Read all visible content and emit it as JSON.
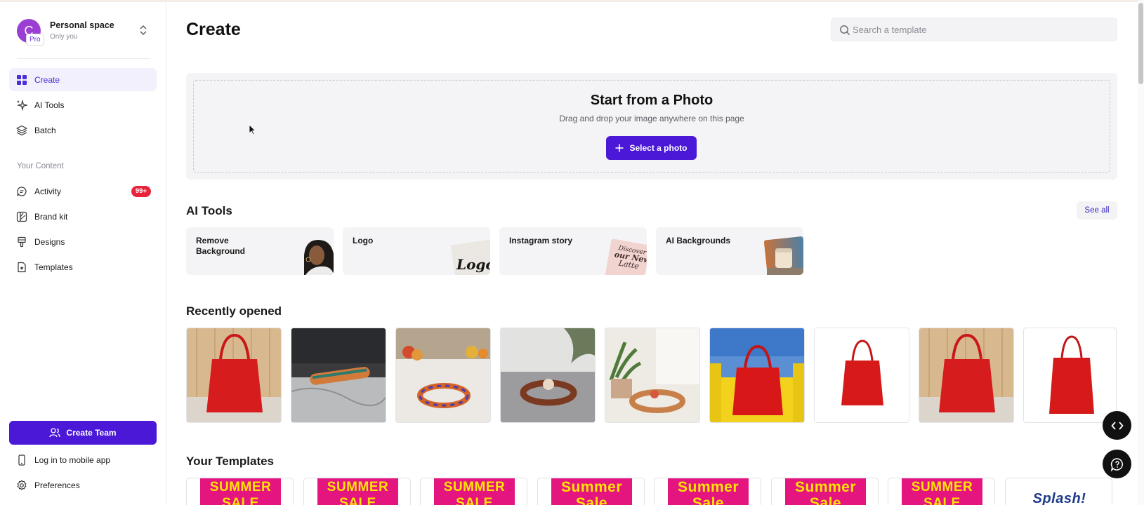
{
  "workspace": {
    "avatar_letter": "C",
    "badge": "Pro",
    "name": "Personal space",
    "subtitle": "Only you"
  },
  "sidebar": {
    "nav": [
      {
        "label": "Create",
        "icon": "grid-icon",
        "active": true
      },
      {
        "label": "AI Tools",
        "icon": "sparkles-icon",
        "active": false
      },
      {
        "label": "Batch",
        "icon": "layers-icon",
        "active": false
      }
    ],
    "content_section": "Your Content",
    "content_items": [
      {
        "label": "Activity",
        "icon": "chat-bubble-icon",
        "badge": "99+"
      },
      {
        "label": "Brand kit",
        "icon": "brand-kit-icon"
      },
      {
        "label": "Designs",
        "icon": "brush-icon"
      },
      {
        "label": "Templates",
        "icon": "template-file-icon"
      }
    ],
    "create_team": "Create Team",
    "mobile_app": "Log in to mobile app",
    "preferences": "Preferences"
  },
  "header": {
    "title": "Create",
    "search_placeholder": "Search a template"
  },
  "photo_upload": {
    "title": "Start from a Photo",
    "subtitle": "Drag and drop your image anywhere on this page",
    "button": "Select a photo"
  },
  "ai_tools": {
    "heading": "AI Tools",
    "see_all": "See all",
    "cards": [
      {
        "label": "Remove Background",
        "thumb": "portrait-woman"
      },
      {
        "label": "Logo",
        "thumb": "logos-sign",
        "thumb_text": "Logos"
      },
      {
        "label": "Instagram story",
        "thumb": "discover-latte-card",
        "thumb_text": "Discover our New Latte"
      },
      {
        "label": "AI Backgrounds",
        "thumb": "candle-jar"
      }
    ]
  },
  "recently_opened": {
    "heading": "Recently opened",
    "items": [
      {
        "name": "red-tote-wood-wall"
      },
      {
        "name": "bracelet-marble-dark"
      },
      {
        "name": "bracelet-kitchen-fruit"
      },
      {
        "name": "bracelet-shadow-plants"
      },
      {
        "name": "bracelet-window-plants"
      },
      {
        "name": "red-tote-yellow-chair"
      },
      {
        "name": "red-tote-white"
      },
      {
        "name": "red-tote-wood-wall-2"
      },
      {
        "name": "red-tote-white-2"
      }
    ]
  },
  "your_templates": {
    "heading": "Your Templates",
    "items": [
      {
        "line1": "SUMMER",
        "line2": "SALE"
      },
      {
        "line1": "SUMMER",
        "line2": "SALE"
      },
      {
        "line1": "SUMMER",
        "line2": "SALE"
      },
      {
        "line1": "Summer",
        "line2": "Sale"
      },
      {
        "line1": "Summer",
        "line2": "Sale"
      },
      {
        "line1": "Summer",
        "line2": "Sale"
      },
      {
        "line1": "SUMMER",
        "line2": "SALE"
      },
      {
        "line1": "Splash!",
        "line2": ""
      }
    ]
  },
  "colors": {
    "accent": "#4a18d6",
    "badge_red": "#e8243c",
    "template_pink": "#e4157e",
    "template_yellow": "#ffe500"
  }
}
